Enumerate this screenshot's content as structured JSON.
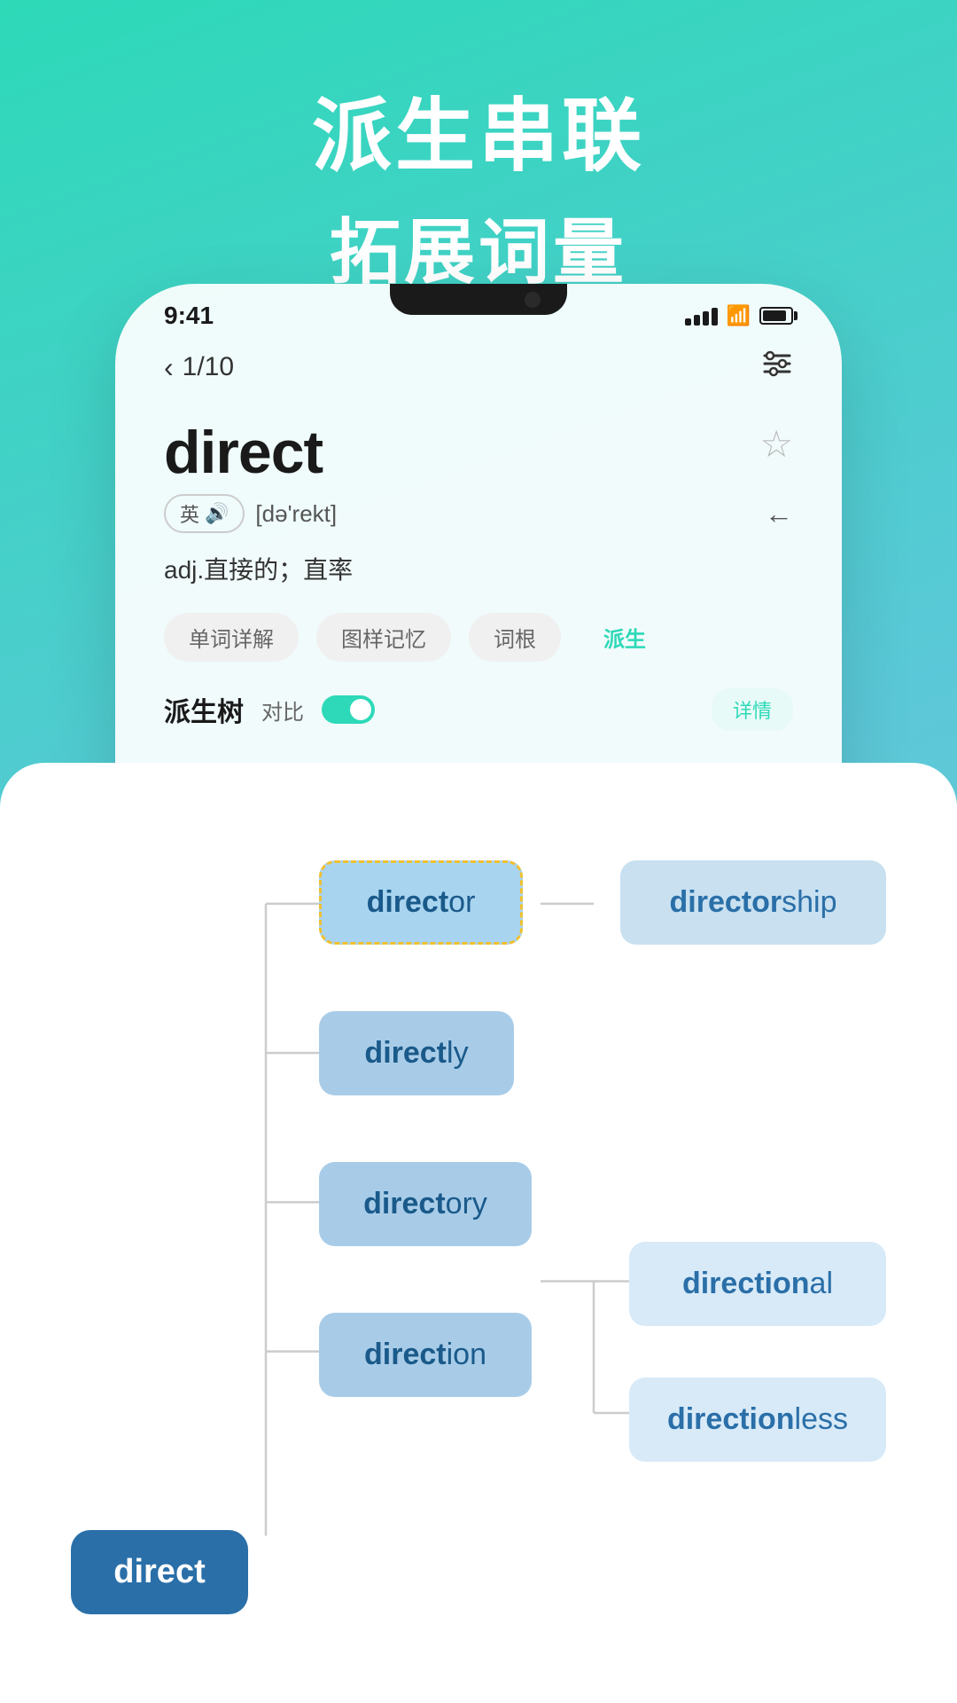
{
  "header": {
    "line1": "派生串联",
    "line2": "拓展词量"
  },
  "phone": {
    "time": "9:41",
    "nav": {
      "back_label": "1/10",
      "filter_icon": "≡"
    },
    "word": {
      "text": "direct",
      "phonetic_label": "英",
      "phonetic_symbol": "[də'rekt]",
      "definition": "adj.直接的；直率",
      "star_icon": "☆",
      "back_icon": "←"
    },
    "tabs": [
      {
        "label": "单词详解",
        "active": false
      },
      {
        "label": "图样记忆",
        "active": false
      },
      {
        "label": "词根",
        "active": false
      },
      {
        "label": "派生",
        "active": true
      }
    ],
    "section": {
      "title": "派生树",
      "compare_label": "对比",
      "detail_label": "详情"
    }
  },
  "tree": {
    "nodes": [
      {
        "id": "root",
        "text_bold": "direct",
        "text_suffix": "",
        "type": "dark"
      },
      {
        "id": "director",
        "text_bold": "direct",
        "text_suffix": "or",
        "type": "selected"
      },
      {
        "id": "directorship",
        "text_bold": "director",
        "text_suffix": "ship",
        "type": "light"
      },
      {
        "id": "directly",
        "text_bold": "direct",
        "text_suffix": "ly",
        "type": "medium"
      },
      {
        "id": "directory",
        "text_bold": "direct",
        "text_suffix": "ory",
        "type": "medium"
      },
      {
        "id": "direction",
        "text_bold": "direct",
        "text_suffix": "ion",
        "type": "medium"
      },
      {
        "id": "directional",
        "text_bold": "direction",
        "text_suffix": "al",
        "type": "light"
      },
      {
        "id": "directionless",
        "text_bold": "direction",
        "text_suffix": "less",
        "type": "light"
      }
    ]
  }
}
